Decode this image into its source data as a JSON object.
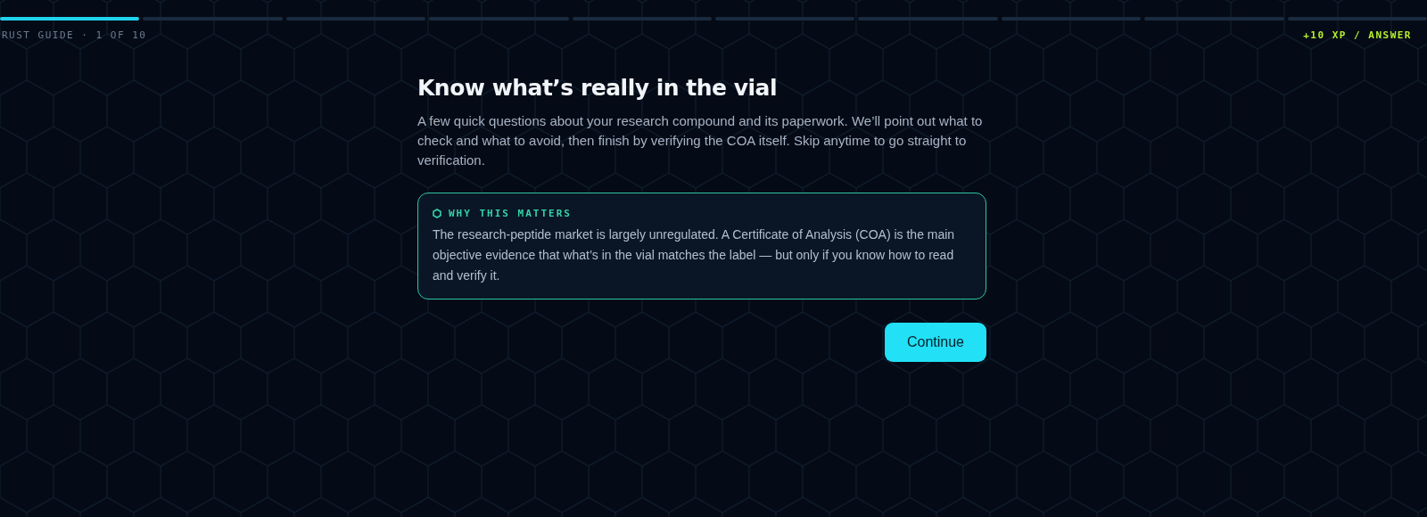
{
  "progress": {
    "segments": [
      {
        "completed": true
      },
      {
        "completed": false
      },
      {
        "completed": false
      },
      {
        "completed": false
      },
      {
        "completed": false
      },
      {
        "completed": false
      },
      {
        "completed": false
      },
      {
        "completed": false
      },
      {
        "completed": false
      },
      {
        "completed": false
      }
    ]
  },
  "header": {
    "step_label": "RUST GUIDE · 1 OF 10",
    "reward": "+10 XP / ANSWER"
  },
  "intro": {
    "title": "Know what’s really in the vial",
    "text": "A few quick questions about your research compound and its paperwork. We’ll point out what to check and what to avoid, then finish by verifying the COA itself. Skip anytime to go straight to verification."
  },
  "callout": {
    "heading": "WHY THIS MATTERS",
    "text": "The research-peptide market is largely unregulated. A Certificate of Analysis (COA) is the main objective evidence that what’s in the vial matches the label — but only if you know how to read and verify it."
  },
  "continue_button": "Continue"
}
